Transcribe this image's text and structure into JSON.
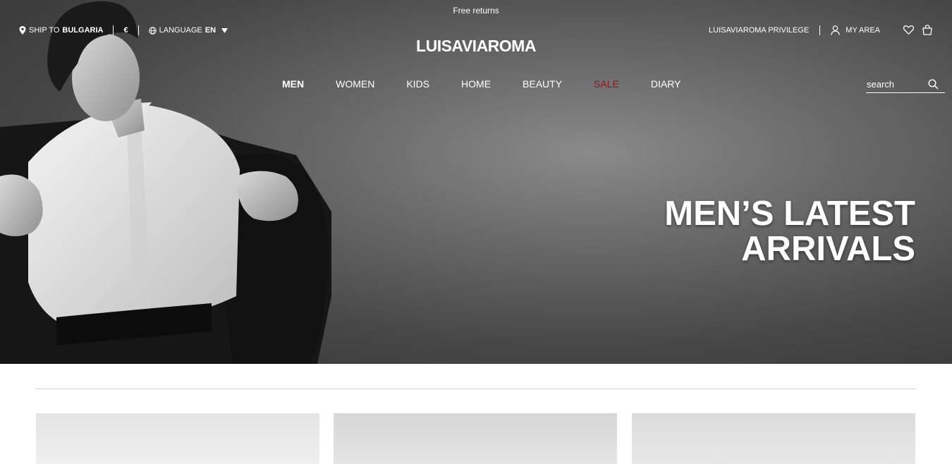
{
  "promo": {
    "text": "Free returns"
  },
  "topbar": {
    "ship_to_label": "SHIP TO",
    "ship_to_country": "BULGARIA",
    "currency": "€",
    "language_label": "LANGUAGE",
    "language_value": "EN",
    "privilege": "LUISAVIAROMA PRIVILEGE",
    "my_area": "MY AREA"
  },
  "logo": "LUISAVIAROMA",
  "nav": {
    "items": [
      "MEN",
      "WOMEN",
      "KIDS",
      "HOME",
      "BEAUTY",
      "SALE",
      "DIARY"
    ],
    "active": "MEN",
    "sale_color": "#8b1a1a"
  },
  "search": {
    "placeholder": "search"
  },
  "hero": {
    "headline_line1": "MEN’S LATEST",
    "headline_line2": "ARRIVALS",
    "tone": "black-and-white"
  },
  "icons": [
    "location-pin-icon",
    "globe-icon",
    "caret-down-icon",
    "user-icon",
    "heart-icon",
    "bag-icon",
    "search-icon"
  ]
}
